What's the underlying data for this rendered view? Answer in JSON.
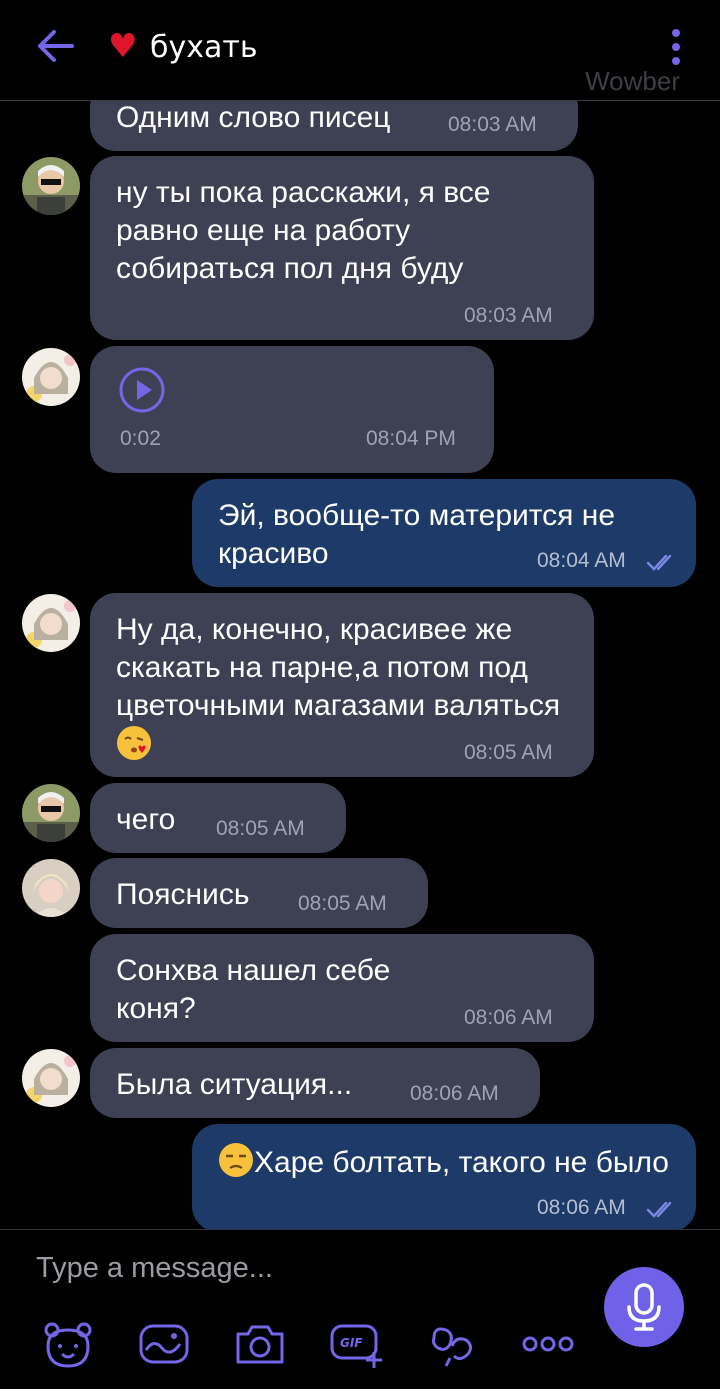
{
  "header": {
    "title": "бухать",
    "watermark": "Wowber",
    "accent_color": "#7466e6",
    "heart_color": "#e0152b"
  },
  "messages": [
    {
      "direction": "in",
      "text": "Одним слово писец",
      "time": "08:03 AM"
    },
    {
      "direction": "in",
      "sender_avatar": "avatar-guy-sunglasses",
      "text": "ну ты пока расскажи, я все равно еще на работу собираться пол дня буду",
      "time": "08:03 AM"
    },
    {
      "direction": "in",
      "sender_avatar": "avatar-girl-flowers",
      "type": "voice",
      "duration": "0:02",
      "time": "08:04 PM"
    },
    {
      "direction": "out",
      "text": "Эй, вообще-то матерится не красиво",
      "time": "08:04 AM",
      "read": true
    },
    {
      "direction": "in",
      "sender_avatar": "avatar-girl-flowers",
      "text": "Ну да, конечно, красивее же скакать на парне,а потом под цветочными магазами валяться",
      "emoji": "kissing-face-with-heart",
      "time": "08:05 AM"
    },
    {
      "direction": "in",
      "sender_avatar": "avatar-guy-sunglasses",
      "text": "чего",
      "time": "08:05 AM"
    },
    {
      "direction": "in",
      "sender_avatar": "avatar-blonde",
      "text": "Пояснись",
      "time": "08:05 AM"
    },
    {
      "direction": "in",
      "text": "Сонхва нашел себе коня?",
      "time": "08:06 AM"
    },
    {
      "direction": "in",
      "sender_avatar": "avatar-girl-flowers",
      "text": "Была ситуация...",
      "time": "08:06 AM"
    },
    {
      "direction": "out",
      "emoji": "unamused-face",
      "text": "Харе болтать, такого не было",
      "time": "08:06 AM",
      "read": true
    }
  ],
  "composer": {
    "placeholder": "Type a message...",
    "tools": [
      "sticker-bear-icon",
      "doodle-icon",
      "camera-icon",
      "gif-icon",
      "link-icon",
      "more-icon"
    ]
  },
  "colors": {
    "incoming_bubble": "#3d4153",
    "outgoing_bubble": "#1e3a68",
    "mic_button": "#7062e8"
  }
}
